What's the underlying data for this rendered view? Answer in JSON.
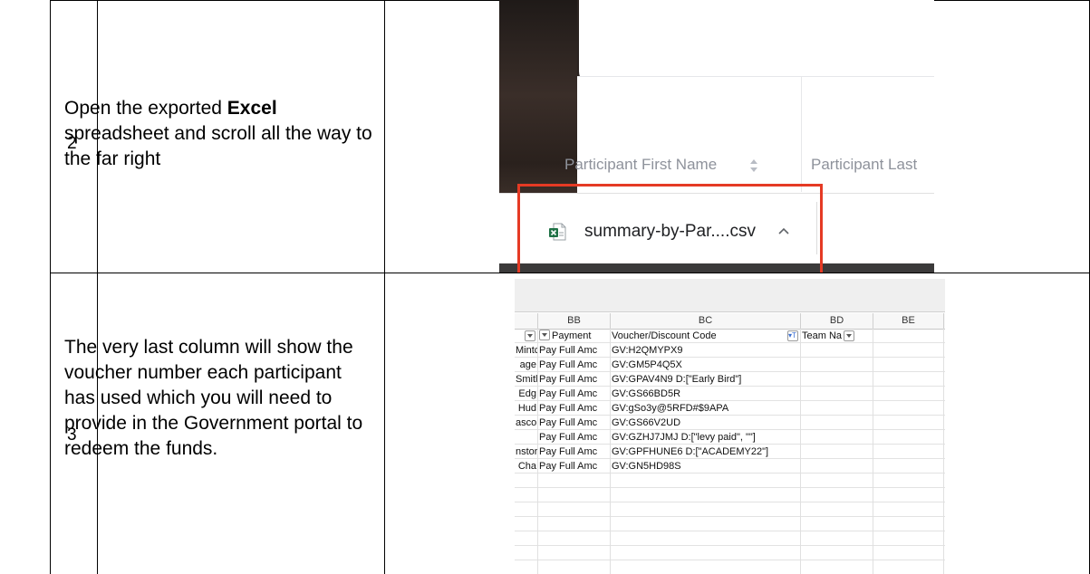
{
  "steps": [
    {
      "number": "2",
      "text_prefix": "Open the exported ",
      "text_bold": "Excel",
      "text_suffix": " spreadsheet and scroll all the way to the far right"
    },
    {
      "number": "3",
      "text": "The very last column will show the voucher number each participant has used which you will need to provide in the Government portal to redeem the funds."
    }
  ],
  "screenshot_download": {
    "column_first": "Participant First Name",
    "column_last": "Participant Last",
    "sort_icon": "sort-arrows-icon",
    "file_icon": "excel-file-icon",
    "download_filename": "summary-by-Par....csv",
    "expand_icon": "chevron-up-icon",
    "highlight_color": "#e53a24"
  },
  "screenshot_sheet": {
    "columns": [
      "BB",
      "BC",
      "BD",
      "BE"
    ],
    "headers": [
      "",
      "Payment",
      "Voucher/Discount Code",
      "Team Na"
    ],
    "rows": [
      [
        "Mintc",
        "Pay Full Amc",
        "GV:H2QMYPX9"
      ],
      [
        "age",
        "Pay Full Amc",
        "GV:GM5P4Q5X"
      ],
      [
        "Smitl",
        "Pay Full Amc",
        "GV:GPAV4N9 D:[\"Early Bird\"]"
      ],
      [
        "Edg",
        "Pay Full Amc",
        "GV:GS66BD5R"
      ],
      [
        "Hud",
        "Pay Full Amc",
        "GV:gSo3y@5RFD#$9APA"
      ],
      [
        "asco",
        "Pay Full Amc",
        "GV:GS66V2UD"
      ],
      [
        "",
        "Pay Full Amc",
        "GV:GZHJ7JMJ D:[\"levy paid\", \"\"]"
      ],
      [
        "nstor",
        "Pay Full Amc",
        "GV:GPFHUNE6 D:[\"ACADEMY22\"]"
      ],
      [
        "Cha",
        "Pay Full Amc",
        "GV:GN5HD98S"
      ]
    ]
  }
}
